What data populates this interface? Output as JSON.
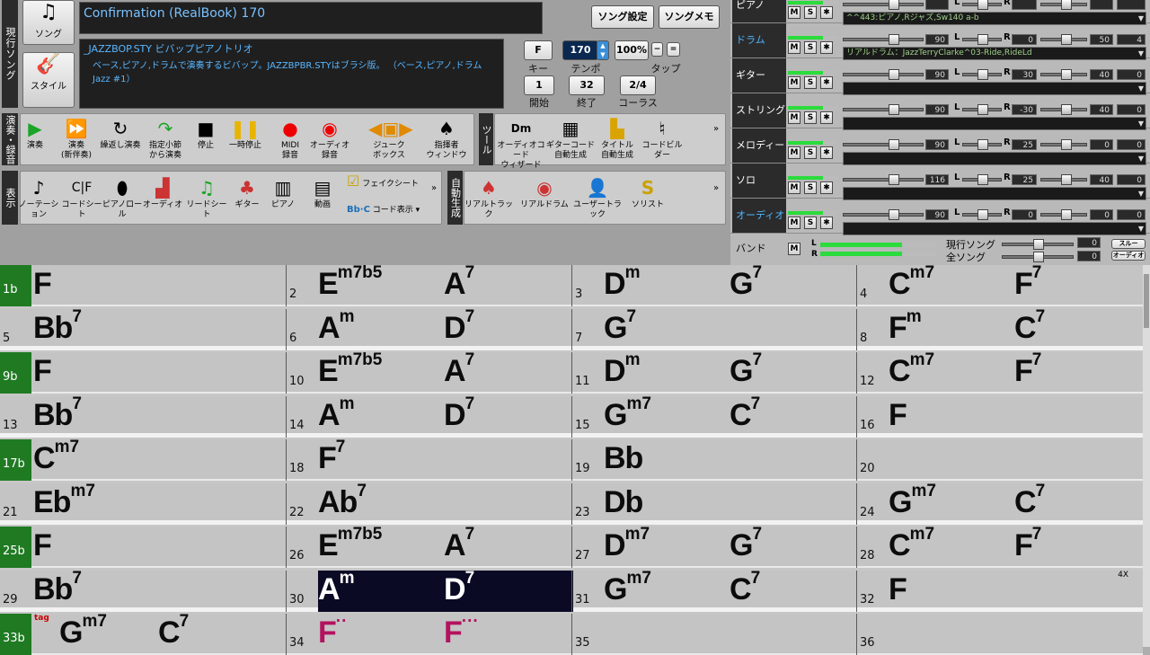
{
  "song_panel": {
    "vertical_label": "現行ソング",
    "song_button": "ソング",
    "style_button": "スタイル",
    "title": "Confirmation (RealBook) 170",
    "style_line1": "_JAZZBOP.STY ビバップピアノトリオ",
    "style_line2": "ベース,ピアノ,ドラムで演奏するビバップ。JAZZBPBR.STYはブラシ版。 （ベース,ピアノ,ドラム Jazz #1）",
    "song_settings": "ソング設定",
    "song_memo": "ソングメモ",
    "key": "F",
    "key_label": "キー",
    "tempo": "170",
    "tempo_label": "テンポ",
    "tempo_pct": "100%",
    "tap_label": "タップ",
    "start": "1",
    "start_label": "開始",
    "end": "32",
    "end_label": "終了",
    "chorus": "2/4",
    "chorus_label": "コーラス"
  },
  "toolbar_play": {
    "section": "演奏・録音",
    "items": [
      "演奏",
      "演奏\n(新伴奏)",
      "繰返し演奏",
      "指定小節\nから演奏",
      "停止",
      "一時停止",
      "MIDI\n録音",
      "オーディオ\n録音",
      "ジューク\nボックス",
      "指揮者\nウィンドウ"
    ]
  },
  "toolbar_tools": {
    "section": "ツール",
    "items": [
      "オーディオコード\nウィザード",
      "ギターコード\n自動生成",
      "タイトル\n自動生成",
      "コードビルダー"
    ]
  },
  "toolbar_view": {
    "section": "表示",
    "items": [
      "ノーテーション",
      "コードシート",
      "ピアノロール",
      "オーディオ",
      "リードシート",
      "ギター",
      "ピアノ",
      "動画",
      "フェイクシート",
      "コード表示"
    ]
  },
  "toolbar_auto": {
    "section": "自動生成",
    "items": [
      "リアルトラック",
      "リアルドラム",
      "ユーザートラック",
      "ソリスト"
    ]
  },
  "mixer": {
    "tracks": [
      {
        "name": "ピアノ",
        "patch": "^^443:ピアノ,Rジャズ,Sw140 a-b",
        "vol": "",
        "pan": "",
        "rev": "",
        "ch": ""
      },
      {
        "name": "ドラム",
        "patch": "リアルドラム：JazzTerryClarke^03-Ride,RideLd",
        "vol": "90",
        "pan": "0",
        "rev": "50",
        "ch": "4"
      },
      {
        "name": "ギター",
        "patch": "",
        "vol": "90",
        "pan": "30",
        "rev": "40",
        "ch": "0"
      },
      {
        "name": "ストリングス",
        "patch": "",
        "vol": "90",
        "pan": "-30",
        "rev": "40",
        "ch": "0"
      },
      {
        "name": "メロディー",
        "patch": "",
        "vol": "90",
        "pan": "25",
        "rev": "0",
        "ch": "0"
      },
      {
        "name": "ソロ",
        "patch": "",
        "vol": "116",
        "pan": "25",
        "rev": "40",
        "ch": "0"
      },
      {
        "name": "オーディオ",
        "patch": "",
        "vol": "90",
        "pan": "0",
        "rev": "0",
        "ch": "0"
      }
    ],
    "band": "バンド",
    "current_song": "現行ソング",
    "all_songs": "全ソング",
    "current_val": "0",
    "all_val": "0",
    "thru": "スルー",
    "audio": "オーディオ"
  },
  "chord_sheet": {
    "rows": [
      [
        {
          "bar": "1b",
          "green": true,
          "chords": [
            {
              "c": "F",
              "q": ""
            }
          ]
        },
        {
          "bar": "2",
          "chords": [
            {
              "c": "E",
              "q": "m7b5"
            },
            {
              "c": "A",
              "q": "7"
            }
          ]
        },
        {
          "bar": "3",
          "chords": [
            {
              "c": "D",
              "q": "m"
            },
            {
              "c": "G",
              "q": "7"
            }
          ]
        },
        {
          "bar": "4",
          "chords": [
            {
              "c": "C",
              "q": "m7"
            },
            {
              "c": "F",
              "q": "7"
            }
          ]
        }
      ],
      [
        {
          "bar": "5",
          "chords": [
            {
              "c": "Bb",
              "q": "7"
            }
          ]
        },
        {
          "bar": "6",
          "chords": [
            {
              "c": "A",
              "q": "m"
            },
            {
              "c": "D",
              "q": "7"
            }
          ]
        },
        {
          "bar": "7",
          "chords": [
            {
              "c": "G",
              "q": "7"
            }
          ]
        },
        {
          "bar": "8",
          "chords": [
            {
              "c": "F",
              "q": "m"
            },
            {
              "c": "C",
              "q": "7"
            }
          ]
        }
      ],
      [
        {
          "bar": "9b",
          "green": true,
          "chords": [
            {
              "c": "F",
              "q": ""
            }
          ]
        },
        {
          "bar": "10",
          "chords": [
            {
              "c": "E",
              "q": "m7b5"
            },
            {
              "c": "A",
              "q": "7"
            }
          ]
        },
        {
          "bar": "11",
          "chords": [
            {
              "c": "D",
              "q": "m"
            },
            {
              "c": "G",
              "q": "7"
            }
          ]
        },
        {
          "bar": "12",
          "chords": [
            {
              "c": "C",
              "q": "m7"
            },
            {
              "c": "F",
              "q": "7"
            }
          ]
        }
      ],
      [
        {
          "bar": "13",
          "chords": [
            {
              "c": "Bb",
              "q": "7"
            }
          ]
        },
        {
          "bar": "14",
          "chords": [
            {
              "c": "A",
              "q": "m"
            },
            {
              "c": "D",
              "q": "7"
            }
          ]
        },
        {
          "bar": "15",
          "chords": [
            {
              "c": "G",
              "q": "m7"
            },
            {
              "c": "C",
              "q": "7"
            }
          ]
        },
        {
          "bar": "16",
          "chords": [
            {
              "c": "F",
              "q": ""
            }
          ]
        }
      ],
      [
        {
          "bar": "17b",
          "green": true,
          "chords": [
            {
              "c": "C",
              "q": "m7"
            }
          ]
        },
        {
          "bar": "18",
          "chords": [
            {
              "c": "F",
              "q": "7"
            }
          ]
        },
        {
          "bar": "19",
          "chords": [
            {
              "c": "Bb",
              "q": ""
            }
          ]
        },
        {
          "bar": "20",
          "chords": []
        }
      ],
      [
        {
          "bar": "21",
          "chords": [
            {
              "c": "Eb",
              "q": "m7"
            }
          ]
        },
        {
          "bar": "22",
          "chords": [
            {
              "c": "Ab",
              "q": "7"
            }
          ]
        },
        {
          "bar": "23",
          "chords": [
            {
              "c": "Db",
              "q": ""
            }
          ]
        },
        {
          "bar": "24",
          "chords": [
            {
              "c": "G",
              "q": "m7"
            },
            {
              "c": "C",
              "q": "7"
            }
          ]
        }
      ],
      [
        {
          "bar": "25b",
          "green": true,
          "chords": [
            {
              "c": "F",
              "q": ""
            }
          ]
        },
        {
          "bar": "26",
          "chords": [
            {
              "c": "E",
              "q": "m7b5"
            },
            {
              "c": "A",
              "q": "7"
            }
          ]
        },
        {
          "bar": "27",
          "chords": [
            {
              "c": "D",
              "q": "m7"
            },
            {
              "c": "G",
              "q": "7"
            }
          ]
        },
        {
          "bar": "28",
          "chords": [
            {
              "c": "C",
              "q": "m7"
            },
            {
              "c": "F",
              "q": "7"
            }
          ]
        }
      ],
      [
        {
          "bar": "29",
          "chords": [
            {
              "c": "Bb",
              "q": "7"
            }
          ]
        },
        {
          "bar": "30",
          "highlight": true,
          "chords": [
            {
              "c": "A",
              "q": "m"
            },
            {
              "c": "D",
              "q": "7"
            }
          ]
        },
        {
          "bar": "31",
          "chords": [
            {
              "c": "G",
              "q": "m7"
            },
            {
              "c": "C",
              "q": "7"
            }
          ]
        },
        {
          "bar": "32",
          "note": "4X",
          "chords": [
            {
              "c": "F",
              "q": ""
            }
          ]
        }
      ],
      [
        {
          "bar": "33b",
          "green": true,
          "tag": "tag",
          "chords": [
            {
              "c": "G",
              "q": "m7"
            },
            {
              "c": "C",
              "q": "7"
            }
          ]
        },
        {
          "bar": "34",
          "chords": [
            {
              "c": "F",
              "q": "··",
              "mag": true
            },
            {
              "c": "F",
              "q": "···",
              "mag": true
            }
          ]
        },
        {
          "bar": "35",
          "chords": []
        },
        {
          "bar": "36",
          "chords": []
        }
      ]
    ]
  },
  "colors": {
    "accent_green": "#1f7a22",
    "magenta_chord": "#b3125e",
    "highlight": "#0a0a24"
  }
}
